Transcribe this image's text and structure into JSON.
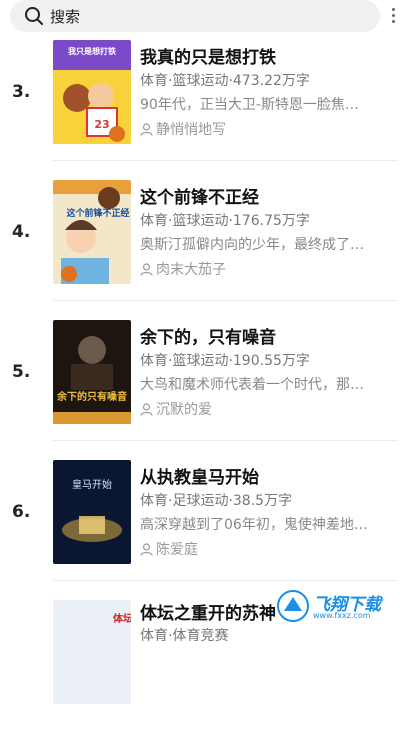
{
  "search": {
    "placeholder": "搜索",
    "search_icon": "search-icon"
  },
  "colors": {
    "accent": "#1a8fe3",
    "title": "#111111",
    "meta": "#777777"
  },
  "books": [
    {
      "rank": "3.",
      "title": "我真的只是想打铁",
      "meta": "体育·篮球运动·473.22万字",
      "desc": "90年代，正当大卫-斯特恩一脸焦…",
      "author": "静悄悄地写",
      "cover_text": "我只是想打铁"
    },
    {
      "rank": "4.",
      "title": "这个前锋不正经",
      "meta": "体育·篮球运动·176.75万字",
      "desc": "奥斯汀孤僻内向的少年，最终成了…",
      "author": "肉末大茄子",
      "cover_text": "这个前锋不正经"
    },
    {
      "rank": "5.",
      "title": "余下的，只有噪音",
      "meta": "体育·篮球运动·190.55万字",
      "desc": "大鸟和魔术师代表着一个时代，那…",
      "author": "沉默的爱",
      "cover_text": "余下的只有噪音"
    },
    {
      "rank": "6.",
      "title": "从执教皇马开始",
      "meta": "体育·足球运动·38.5万字",
      "desc": "高深穿越到了06年初，鬼使神差地…",
      "author": "陈爱庭",
      "cover_text": "皇马开始"
    },
    {
      "rank": "",
      "title": "体坛之重开的苏神",
      "meta": "体育·体育竞赛",
      "desc": "",
      "author": "",
      "cover_text": "体坛"
    }
  ],
  "watermark": {
    "name": "飞翔下载",
    "url": "www.fxxz.com"
  }
}
